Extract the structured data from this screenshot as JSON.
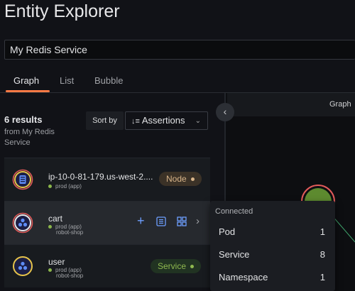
{
  "page": {
    "title": "Entity Explorer"
  },
  "search": {
    "value": "My Redis Service"
  },
  "tabs": [
    {
      "label": "Graph",
      "active": true
    },
    {
      "label": "List",
      "active": false
    },
    {
      "label": "Bubble",
      "active": false
    }
  ],
  "results": {
    "count_label": "6 results",
    "from_label": "from My Redis Service"
  },
  "sort": {
    "label": "Sort by",
    "selected": "Assertions"
  },
  "rows": [
    {
      "name": "ip-10-0-81-179.us-west-2....",
      "meta": [
        "prod (app)"
      ],
      "badge": "Node",
      "badge_color": "#c9a173"
    },
    {
      "name": "cart",
      "meta": [
        "prod (app)",
        "robot-shop"
      ],
      "badge": "",
      "badge_color": ""
    },
    {
      "name": "user",
      "meta": [
        "prod (app)",
        "robot-shop"
      ],
      "badge": "Service",
      "badge_color": "#8fb94f"
    }
  ],
  "graph": {
    "header": "Graph"
  },
  "popover": {
    "title": "Connected",
    "items": [
      {
        "label": "Pod",
        "count": "1"
      },
      {
        "label": "Service",
        "count": "8"
      },
      {
        "label": "Namespace",
        "count": "1"
      }
    ]
  },
  "colors": {
    "accent": "#ff7a45",
    "action_blue": "#6e9fff",
    "status_green": "#8ab54a"
  }
}
